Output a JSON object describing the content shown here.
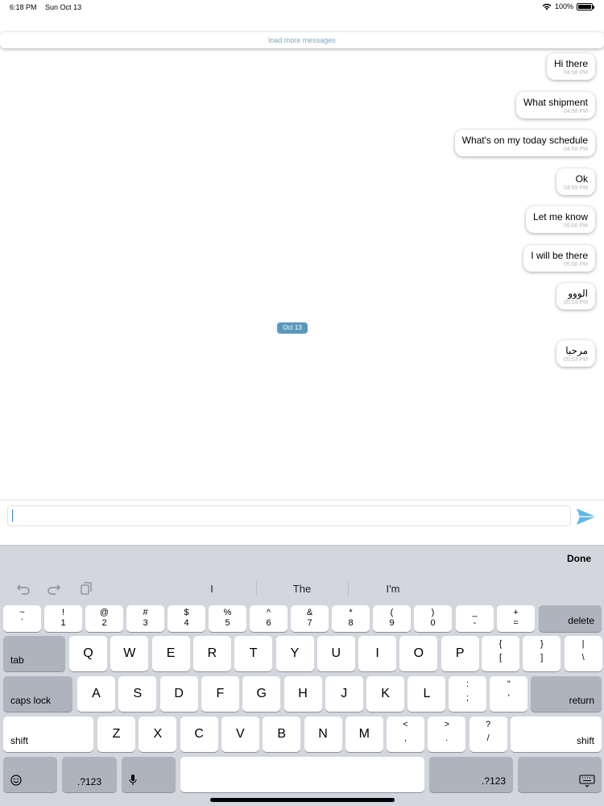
{
  "status": {
    "time": "6:18 PM",
    "date": "Sun Oct 13",
    "battery": "100%",
    "battery_level": 1.0
  },
  "chat": {
    "load_more": "load more messages",
    "messages": [
      {
        "text": "Hi there",
        "time": "04:58 PM"
      },
      {
        "text": "What shipment",
        "time": "04:58 PM"
      },
      {
        "text": "What's on my today schedule",
        "time": "04:59 PM"
      },
      {
        "text": "Ok",
        "time": "04:59 PM"
      },
      {
        "text": "Let me know",
        "time": "05:00 PM"
      },
      {
        "text": "I will be there",
        "time": "05:00 PM"
      },
      {
        "text": "الووو",
        "time": "05:03 PM"
      },
      {
        "text": "مرحبا",
        "time": "05:03 PM"
      }
    ],
    "date_chip": "Oct 13"
  },
  "composer": {
    "value": "",
    "placeholder": ""
  },
  "keyboard": {
    "done": "Done",
    "suggestions": [
      "I",
      "The",
      "I'm"
    ],
    "number_row": [
      {
        "top": "~",
        "bot": "`"
      },
      {
        "top": "!",
        "bot": "1"
      },
      {
        "top": "@",
        "bot": "2"
      },
      {
        "top": "#",
        "bot": "3"
      },
      {
        "top": "$",
        "bot": "4"
      },
      {
        "top": "%",
        "bot": "5"
      },
      {
        "top": "^",
        "bot": "6"
      },
      {
        "top": "&",
        "bot": "7"
      },
      {
        "top": "*",
        "bot": "8"
      },
      {
        "top": "(",
        "bot": "9"
      },
      {
        "top": ")",
        "bot": "0"
      },
      {
        "top": "_",
        "bot": "-"
      },
      {
        "top": "+",
        "bot": "="
      }
    ],
    "delete": "delete",
    "tab": "tab",
    "row_q": [
      "Q",
      "W",
      "E",
      "R",
      "T",
      "Y",
      "U",
      "I",
      "O",
      "P"
    ],
    "row_q_punct": [
      {
        "top": "{",
        "bot": "["
      },
      {
        "top": "}",
        "bot": "]"
      },
      {
        "top": "|",
        "bot": "\\"
      }
    ],
    "caps_lock": "caps lock",
    "row_a": [
      "A",
      "S",
      "D",
      "F",
      "G",
      "H",
      "J",
      "K",
      "L"
    ],
    "row_a_punct": [
      {
        "top": ":",
        "bot": ";"
      },
      {
        "top": "\"",
        "bot": "'"
      }
    ],
    "return": "return",
    "shift": "shift",
    "row_z": [
      "Z",
      "X",
      "C",
      "V",
      "B",
      "N",
      "M"
    ],
    "row_z_punct": [
      {
        "top": "<",
        "bot": ","
      },
      {
        "top": ">",
        "bot": "."
      },
      {
        "top": "?",
        "bot": "/"
      }
    ],
    "num_switch": ".?123"
  }
}
